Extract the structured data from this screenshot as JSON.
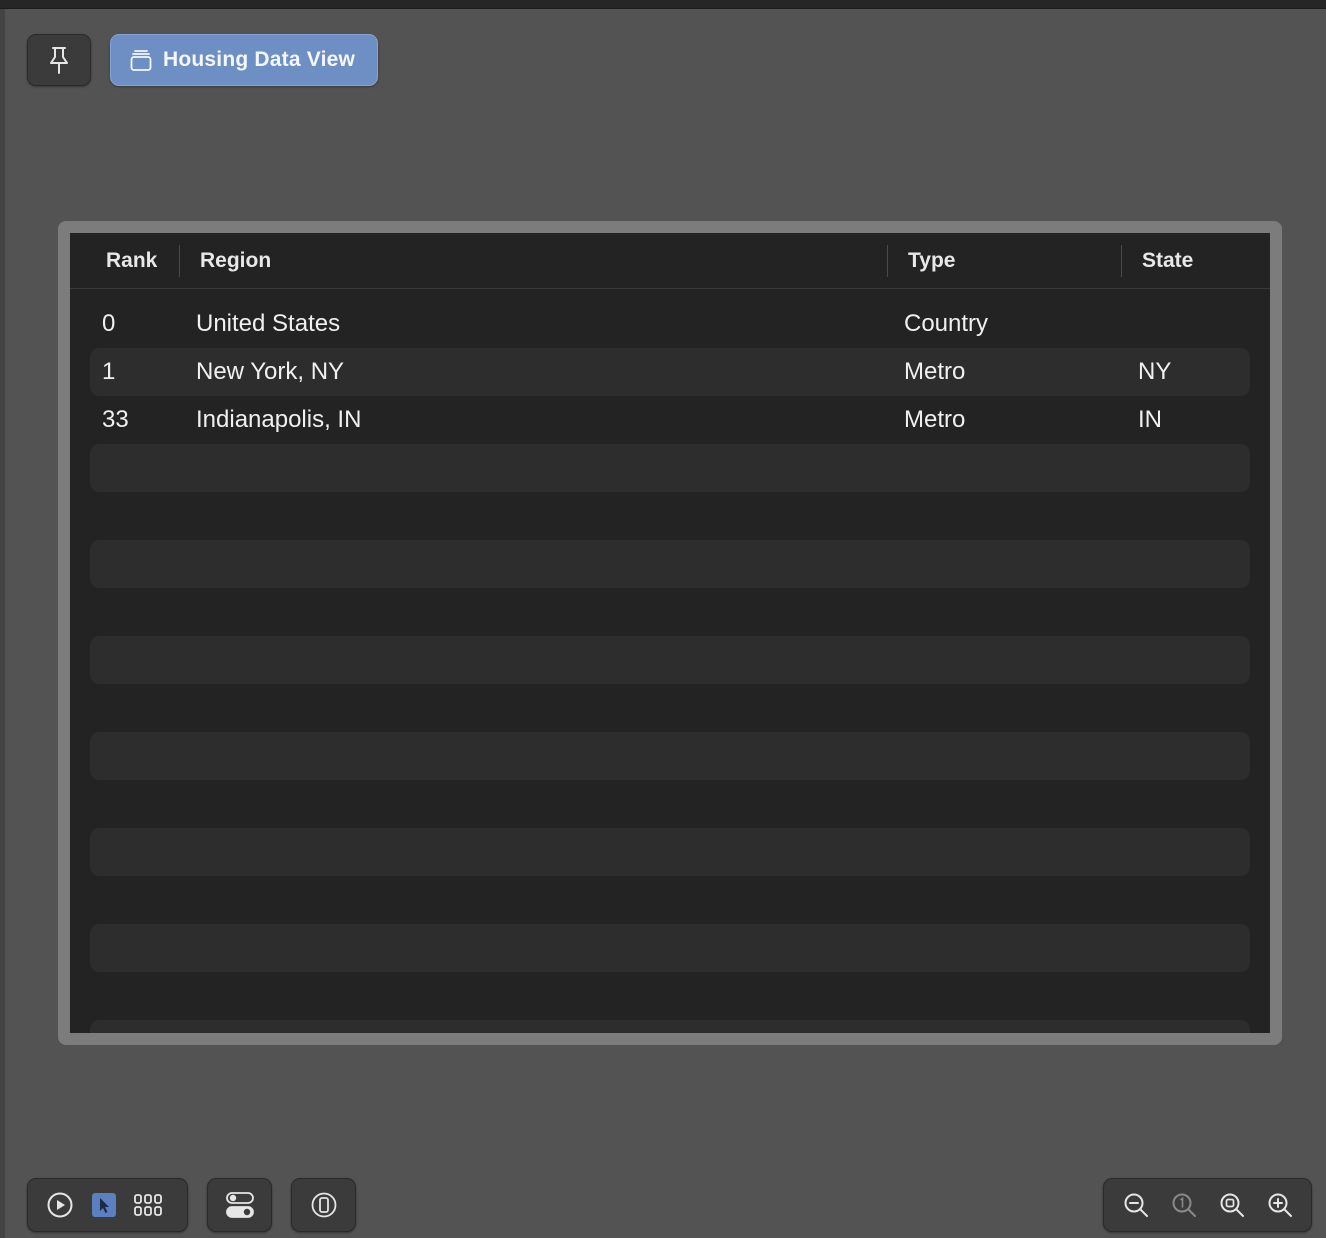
{
  "toolbar": {
    "pin_icon": "pin-icon",
    "preview_tab_icon": "stack-icon",
    "preview_tab_label": "Housing Data View",
    "preview_tab_color": "#6e8fc4"
  },
  "table": {
    "columns": [
      "Rank",
      "Region",
      "Type",
      "State"
    ],
    "rows": [
      {
        "rank": "0",
        "region": "United States",
        "type": "Country",
        "state": ""
      },
      {
        "rank": "1",
        "region": "New York, NY",
        "type": "Metro",
        "state": "NY"
      },
      {
        "rank": "33",
        "region": "Indianapolis, IN",
        "type": "Metro",
        "state": "IN"
      }
    ]
  },
  "bottom_bar": {
    "left_controls": [
      "play-icon",
      "select-icon",
      "grid-icon"
    ],
    "variants_icon": "toggle-icon",
    "device_icon": "device-icon",
    "zoom_controls": [
      "zoom-out-icon",
      "zoom-actual-size-icon",
      "zoom-to-fit-icon",
      "zoom-in-icon"
    ],
    "selected_color": "#5b7fc0"
  }
}
